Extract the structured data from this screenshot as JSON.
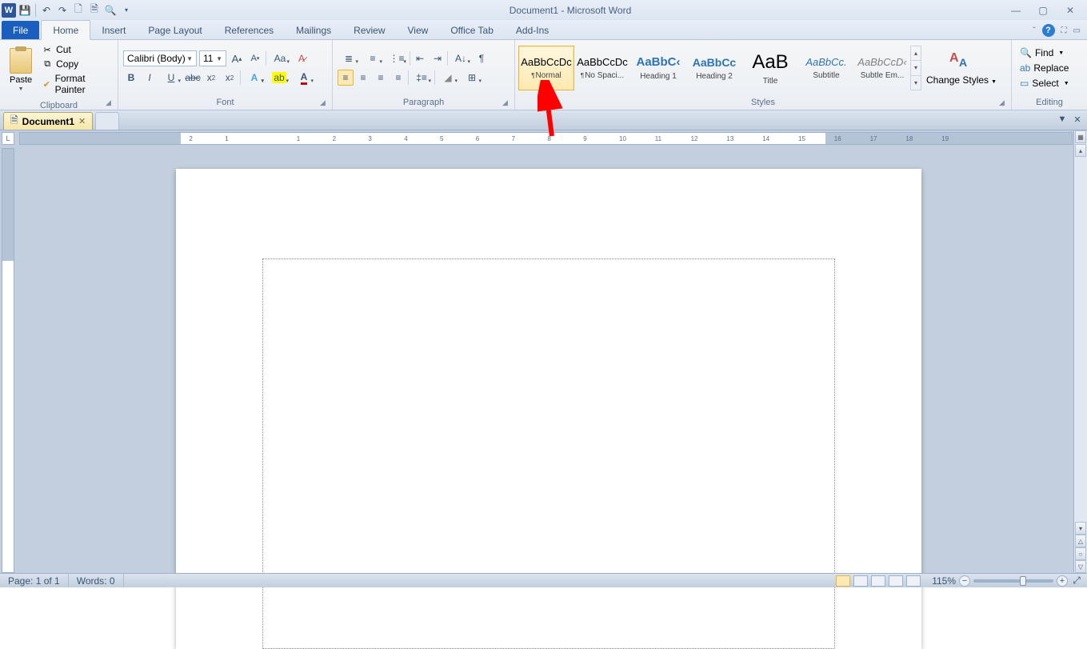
{
  "titlebar": {
    "title": "Document1 - Microsoft Word"
  },
  "tabs": {
    "file": "File",
    "items": [
      "Home",
      "Insert",
      "Page Layout",
      "References",
      "Mailings",
      "Review",
      "View",
      "Office Tab",
      "Add-Ins"
    ],
    "active": 0
  },
  "clipboard": {
    "paste": "Paste",
    "cut": "Cut",
    "copy": "Copy",
    "format_painter": "Format Painter",
    "label": "Clipboard"
  },
  "font": {
    "name": "Calibri (Body)",
    "size": "11",
    "label": "Font"
  },
  "paragraph": {
    "label": "Paragraph"
  },
  "styles": {
    "label": "Styles",
    "change_styles": "Change Styles",
    "items": [
      {
        "preview": "AaBbCcDc",
        "name": "¶ Normal",
        "color": "#000",
        "ff": "normal",
        "fs": "13px",
        "fw": "normal",
        "selected": true
      },
      {
        "preview": "AaBbCcDc",
        "name": "¶ No Spaci...",
        "color": "#000",
        "ff": "normal",
        "fs": "13px",
        "fw": "normal",
        "selected": false
      },
      {
        "preview": "AaBbC‹",
        "name": "Heading 1",
        "color": "#2e74b5",
        "ff": "normal",
        "fs": "15px",
        "fw": "bold",
        "selected": false
      },
      {
        "preview": "AaBbCc",
        "name": "Heading 2",
        "color": "#2e74b5",
        "ff": "normal",
        "fs": "14px",
        "fw": "bold",
        "selected": false
      },
      {
        "preview": "AaB",
        "name": "Title",
        "color": "#000",
        "ff": "normal",
        "fs": "24px",
        "fw": "normal",
        "selected": false
      },
      {
        "preview": "AaBbCc.",
        "name": "Subtitle",
        "color": "#2e74b5",
        "ff": "italic",
        "fs": "13px",
        "fw": "normal",
        "selected": false
      },
      {
        "preview": "AaBbCcD‹",
        "name": "Subtle Em...",
        "color": "#808080",
        "ff": "italic",
        "fs": "13px",
        "fw": "normal",
        "selected": false
      }
    ]
  },
  "editing": {
    "find": "Find",
    "replace": "Replace",
    "select": "Select",
    "label": "Editing"
  },
  "doctab": {
    "name": "Document1"
  },
  "ruler": {
    "marks": [
      2,
      1,
      1,
      2,
      3,
      4,
      5,
      6,
      7,
      8,
      9,
      10,
      11,
      12,
      13,
      14,
      15,
      16,
      17,
      18,
      19
    ]
  },
  "status": {
    "page": "Page: 1 of 1",
    "words": "Words: 0",
    "zoom": "115%"
  }
}
